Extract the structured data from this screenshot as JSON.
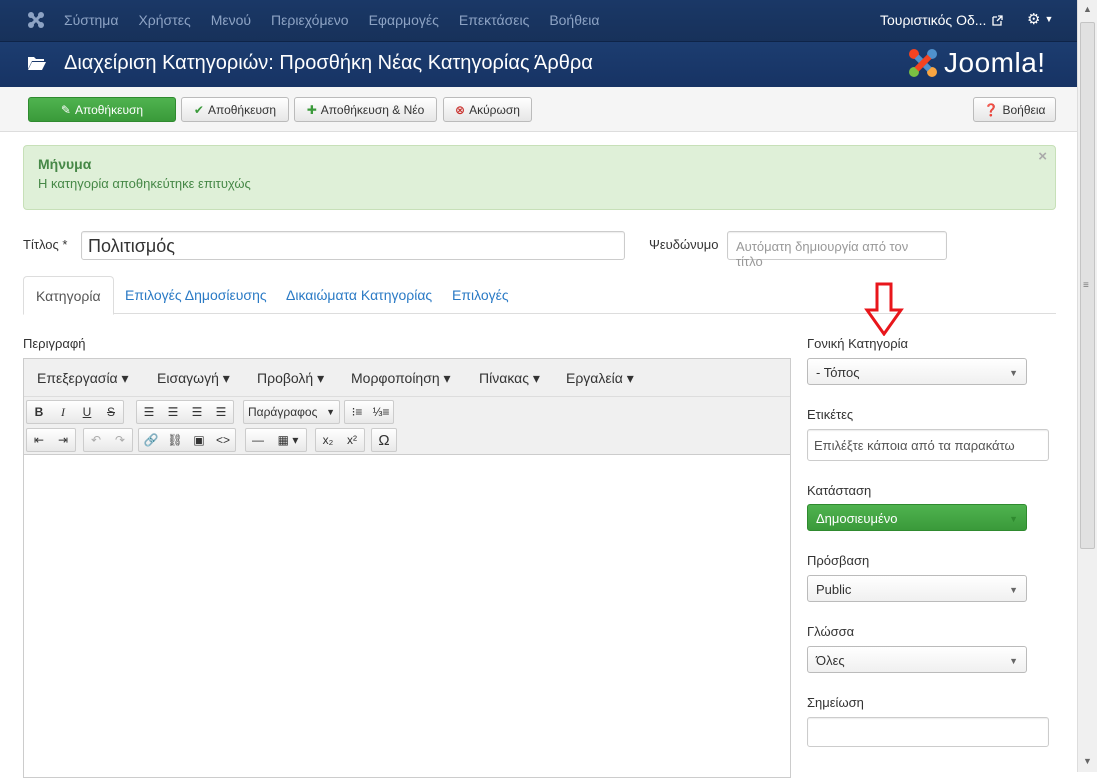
{
  "topnav": {
    "menu": [
      "Σύστημα",
      "Χρήστες",
      "Μενού",
      "Περιεχόμενο",
      "Εφαρμογές",
      "Επεκτάσεις",
      "Βοήθεια"
    ],
    "site_name": "Τουριστικός Οδ..."
  },
  "header": {
    "title": "Διαχείριση Κατηγοριών: Προσθήκη Νέας Κατηγορίας Άρθρα",
    "brand": "Joomla!"
  },
  "toolbar": {
    "save_label": "Αποθήκευση",
    "save_close_label": "Αποθήκευση",
    "save_new_label": "Αποθήκευση & Νέο",
    "cancel_label": "Ακύρωση",
    "help_label": "Βοήθεια"
  },
  "message": {
    "heading": "Μήνυμα",
    "text": "Η κατηγορία αποθηκεύτηκε επιτυχώς"
  },
  "form": {
    "title_label": "Τίτλος *",
    "title_value": "Πολιτισμός",
    "alias_label": "Ψευδώνυμο",
    "alias_placeholder": "Αυτόματη δημιουργία από τον τίτλο"
  },
  "tabs": [
    "Κατηγορία",
    "Επιλογές Δημοσίευσης",
    "Δικαιώματα Κατηγορίας",
    "Επιλογές"
  ],
  "editor": {
    "label": "Περιγραφή",
    "menus": [
      "Επεξεργασία",
      "Εισαγωγή",
      "Προβολή",
      "Μορφοποίηση",
      "Πίνακας",
      "Εργαλεία"
    ],
    "format_select": "Παράγραφος"
  },
  "sidebar": {
    "parent_label": "Γονική Κατηγορία",
    "parent_value": "- Τόπος",
    "tags_label": "Ετικέτες",
    "tags_placeholder": "Επιλέξτε κάποια από τα παρακάτω",
    "status_label": "Κατάσταση",
    "status_value": "Δημοσιευμένο",
    "access_label": "Πρόσβαση",
    "access_value": "Public",
    "language_label": "Γλώσσα",
    "language_value": "Όλες",
    "note_label": "Σημείωση"
  },
  "colors": {
    "nav_bg": "#1a3867",
    "success": "#46a546",
    "link": "#2a7ac5",
    "annotation_arrow": "#e8161b"
  }
}
